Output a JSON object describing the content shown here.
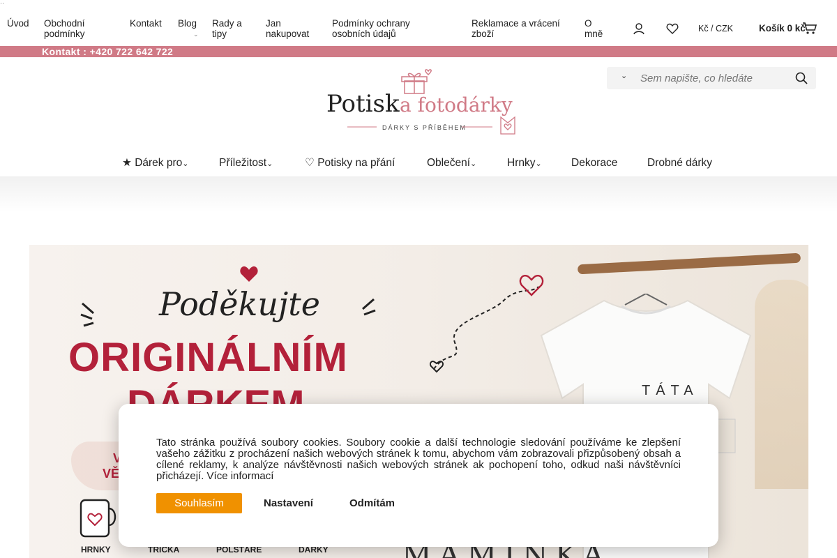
{
  "topnav": {
    "corner": "··",
    "items": [
      "Úvod",
      "Obchodní podmínky",
      "Kontakt",
      "Blog",
      "Rady a tipy",
      "Jan nakupovat",
      "Podmínky ochrany osobních údajů",
      "Reklamace a vrácení zboží",
      "O mně"
    ],
    "currency": "Kč / CZK",
    "cart": "Košík 0 kč"
  },
  "contact_bar": {
    "text": "Kontakt : +420 722 642 722"
  },
  "logo": {
    "name_a": "Potisk",
    "name_b": " a fotodárky",
    "tagline": "DÁRKY S PŘÍBĚHEM"
  },
  "search": {
    "placeholder": "Sem napište, co hledáte"
  },
  "mainnav": [
    "★ Dárek pro",
    "Příležitost",
    "♡ Potisky na přání",
    "Oblečení",
    "Hrnky",
    "Dekorace",
    "Drobné dárky"
  ],
  "banner": {
    "headline1": "Poděkujte",
    "headline2": "ORIGINÁLNÍM",
    "headline3": "DÁRKEM",
    "promo1": "V",
    "promo2": "VĚ",
    "categories": [
      "HRNKY",
      "TRIČKA",
      "POLŠTÁŘE",
      "DÁRKY"
    ],
    "shirt_top": "TÁTA",
    "shirt_bottom": "MAMINKA"
  },
  "cookies": {
    "text": "Tato stránka používá soubory cookies. Soubory cookie a další technologie sledování používáme ke zlepšení vašeho zážitku z procházení našich webových stránek k tomu, abychom vám zobrazovali přizpůsobený obsah a cílené reklamy, k analýze návštěvnosti našich webových stránek ak pochopení toho, odkud naši návštěvníci přicházejí. Více informací",
    "accept": "Souhlasím",
    "settings": "Nastavení",
    "reject": "Odmítám"
  },
  "colors": {
    "accent": "#d07a86",
    "brand_red": "#b3213a",
    "button_orange": "#f09100"
  }
}
